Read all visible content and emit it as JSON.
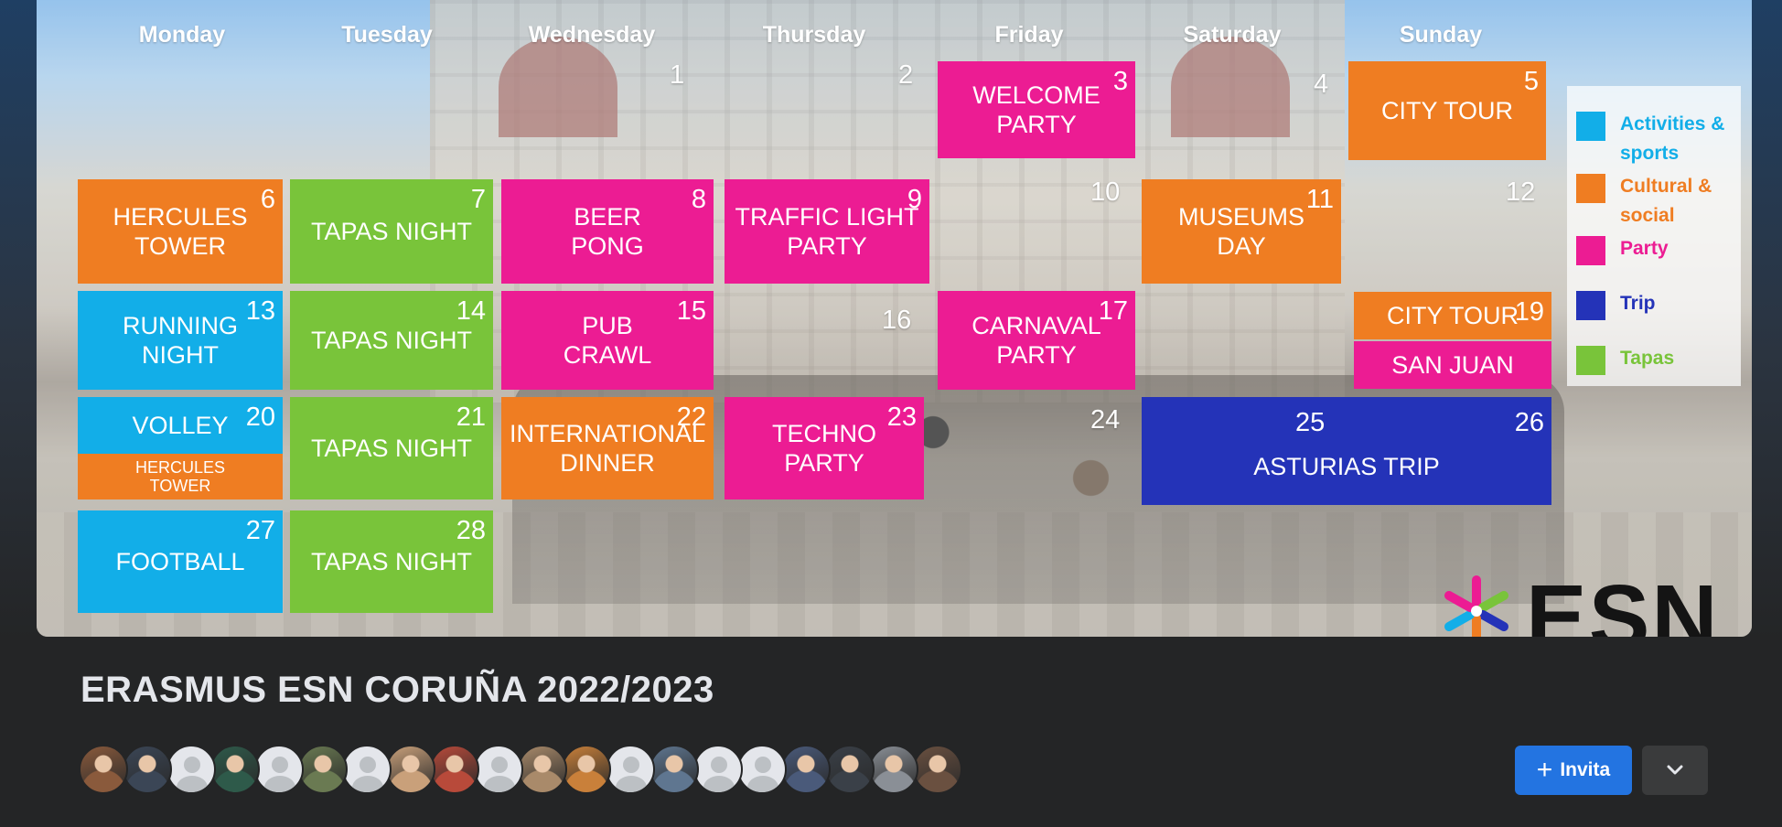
{
  "event": {
    "title": "ERASMUS ESN CORUÑA 2022/2023",
    "invite_label": "Invita",
    "more_icon": "chevron-down-icon"
  },
  "calendar": {
    "days": [
      "Monday",
      "Tuesday",
      "Wednesday",
      "Thursday",
      "Friday",
      "Saturday",
      "Sunday"
    ],
    "plain_dates": [
      "1",
      "2",
      "4",
      "10",
      "12",
      "16",
      "24"
    ],
    "events": [
      {
        "name": "welcome",
        "date": "3",
        "label": "WELCOME\nPARTY",
        "category": "party"
      },
      {
        "name": "city-tour-5",
        "date": "5",
        "label": "CITY TOUR",
        "category": "cultural"
      },
      {
        "name": "hercules-tower-6",
        "date": "6",
        "label": "HERCULES\nTOWER",
        "category": "cultural"
      },
      {
        "name": "tapas-7",
        "date": "7",
        "label": "TAPAS NIGHT",
        "category": "tapas"
      },
      {
        "name": "beer-pong",
        "date": "8",
        "label": "BEER\nPONG",
        "category": "party"
      },
      {
        "name": "traffic-light",
        "date": "9",
        "label": "TRAFFIC LIGHT\nPARTY",
        "category": "party"
      },
      {
        "name": "museums-day",
        "date": "11",
        "label": "MUSEUMS\nDAY",
        "category": "cultural"
      },
      {
        "name": "running-night",
        "date": "13",
        "label": "RUNNING\nNIGHT",
        "category": "activities"
      },
      {
        "name": "tapas-14",
        "date": "14",
        "label": "TAPAS NIGHT",
        "category": "tapas"
      },
      {
        "name": "pub-crawl",
        "date": "15",
        "label": "PUB\nCRAWL",
        "category": "party"
      },
      {
        "name": "carnaval",
        "date": "17",
        "label": "CARNAVAL\nPARTY",
        "category": "party"
      },
      {
        "name": "city-tour-19",
        "date": "19",
        "label": "CITY TOUR",
        "category": "cultural"
      },
      {
        "name": "san-juan",
        "date": "",
        "label": "SAN JUAN",
        "category": "party"
      },
      {
        "name": "volley",
        "date": "20",
        "label": "VOLLEY",
        "category": "activities"
      },
      {
        "name": "hercules-tower-20",
        "date": "",
        "label": "HERCULES\nTOWER",
        "category": "cultural"
      },
      {
        "name": "tapas-21",
        "date": "21",
        "label": "TAPAS NIGHT",
        "category": "tapas"
      },
      {
        "name": "international-dinner",
        "date": "22",
        "label": "INTERNATIONAL\nDINNER",
        "category": "cultural"
      },
      {
        "name": "techno",
        "date": "23",
        "label": "TECHNO\nPARTY",
        "category": "party"
      },
      {
        "name": "asturias-trip",
        "date": "25",
        "date2": "26",
        "label": "ASTURIAS TRIP",
        "category": "trip"
      },
      {
        "name": "football",
        "date": "27",
        "label": "FOOTBALL",
        "category": "activities"
      },
      {
        "name": "tapas-28",
        "date": "28",
        "label": "TAPAS NIGHT",
        "category": "tapas"
      }
    ]
  },
  "legend": [
    {
      "key": "activities",
      "label": "Activities & sports",
      "color": "#12aee8",
      "text_color": "#12aee8"
    },
    {
      "key": "cultural",
      "label": "Cultural & social",
      "color": "#ef7d22",
      "text_color": "#ef7d22"
    },
    {
      "key": "party",
      "label": "Party",
      "color": "#ec1c93",
      "text_color": "#ec1c93"
    },
    {
      "key": "trip",
      "label": "Trip",
      "color": "#2433b8",
      "text_color": "#2433b8"
    },
    {
      "key": "tapas",
      "label": "Tapas",
      "color": "#79c43a",
      "text_color": "#79c43a"
    }
  ],
  "logo": {
    "text": "ESN"
  },
  "attendees": [
    {
      "type": "photo",
      "color": "#8a5a3c"
    },
    {
      "type": "photo",
      "color": "#3b4656"
    },
    {
      "type": "placeholder"
    },
    {
      "type": "photo",
      "color": "#2e5a4a"
    },
    {
      "type": "placeholder"
    },
    {
      "type": "photo",
      "color": "#6a7a52"
    },
    {
      "type": "placeholder"
    },
    {
      "type": "photo",
      "color": "#c9a07a"
    },
    {
      "type": "photo",
      "color": "#b84a3a"
    },
    {
      "type": "placeholder"
    },
    {
      "type": "photo",
      "color": "#a98a6a"
    },
    {
      "type": "photo",
      "color": "#c9803a"
    },
    {
      "type": "placeholder"
    },
    {
      "type": "photo",
      "color": "#5f7690"
    },
    {
      "type": "placeholder"
    },
    {
      "type": "placeholder"
    },
    {
      "type": "photo",
      "color": "#4a5a7a"
    },
    {
      "type": "photo",
      "color": "#3a4048"
    },
    {
      "type": "photo",
      "color": "#8a8f96"
    },
    {
      "type": "photo",
      "color": "#6a5040"
    }
  ]
}
